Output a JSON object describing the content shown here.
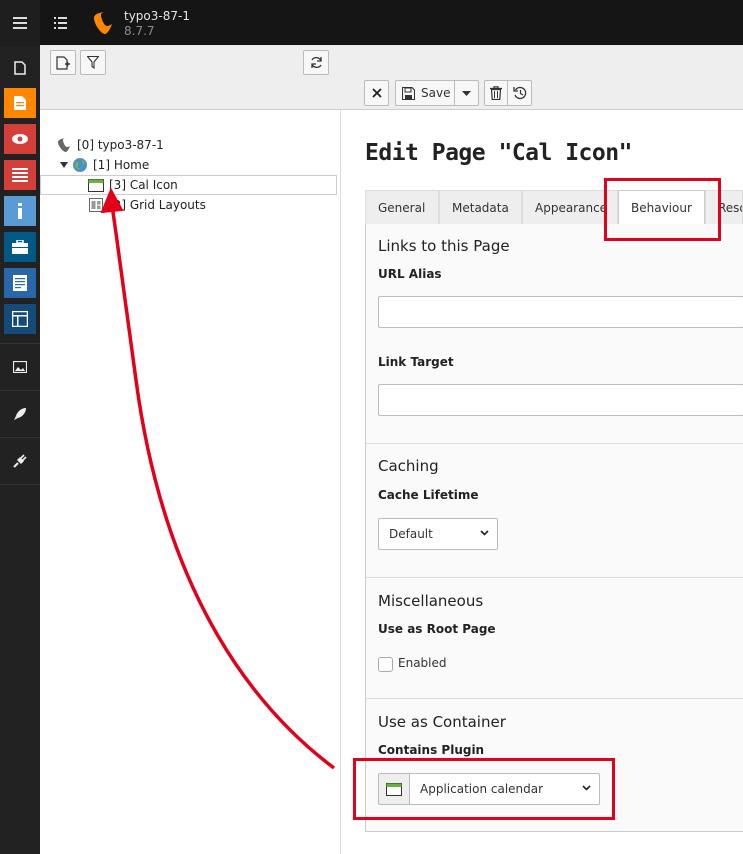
{
  "header": {
    "site_name": "typo3-87-1",
    "site_version": "8.7.7"
  },
  "modules": [
    {
      "name": "page-module",
      "color": "#ff8700"
    },
    {
      "name": "view-module",
      "color": "#e2001a"
    },
    {
      "name": "list-module",
      "color": "#e2001a"
    },
    {
      "name": "info-module",
      "color": "#5b9bd5"
    },
    {
      "name": "workspaces-module",
      "color": "#005a85"
    },
    {
      "name": "template-module",
      "color": "#2868a8"
    },
    {
      "name": "layout-module",
      "color": "#134b7a"
    }
  ],
  "tree": {
    "root": "[0] typo3-87-1",
    "home": "[1] Home",
    "cal_icon": "[3] Cal Icon",
    "grid_layouts": "[2] Grid Layouts"
  },
  "toolbar": {
    "save_label": "Save"
  },
  "page": {
    "title": "Edit Page \"Cal Icon\""
  },
  "tabs": [
    "General",
    "Metadata",
    "Appearance",
    "Behaviour",
    "Reso"
  ],
  "form": {
    "links_title": "Links to this Page",
    "url_alias_label": "URL Alias",
    "url_alias_value": "",
    "link_target_label": "Link Target",
    "link_target_value": "",
    "caching_title": "Caching",
    "cache_lifetime_label": "Cache Lifetime",
    "cache_lifetime_value": "Default",
    "misc_title": "Miscellaneous",
    "root_page_label": "Use as Root Page",
    "root_page_checkbox_label": "Enabled",
    "container_title": "Use as Container",
    "contains_plugin_label": "Contains Plugin",
    "contains_plugin_value": "Application calendar"
  },
  "colors": {
    "accent": "#ff8700",
    "annotation": "#e2001a"
  }
}
